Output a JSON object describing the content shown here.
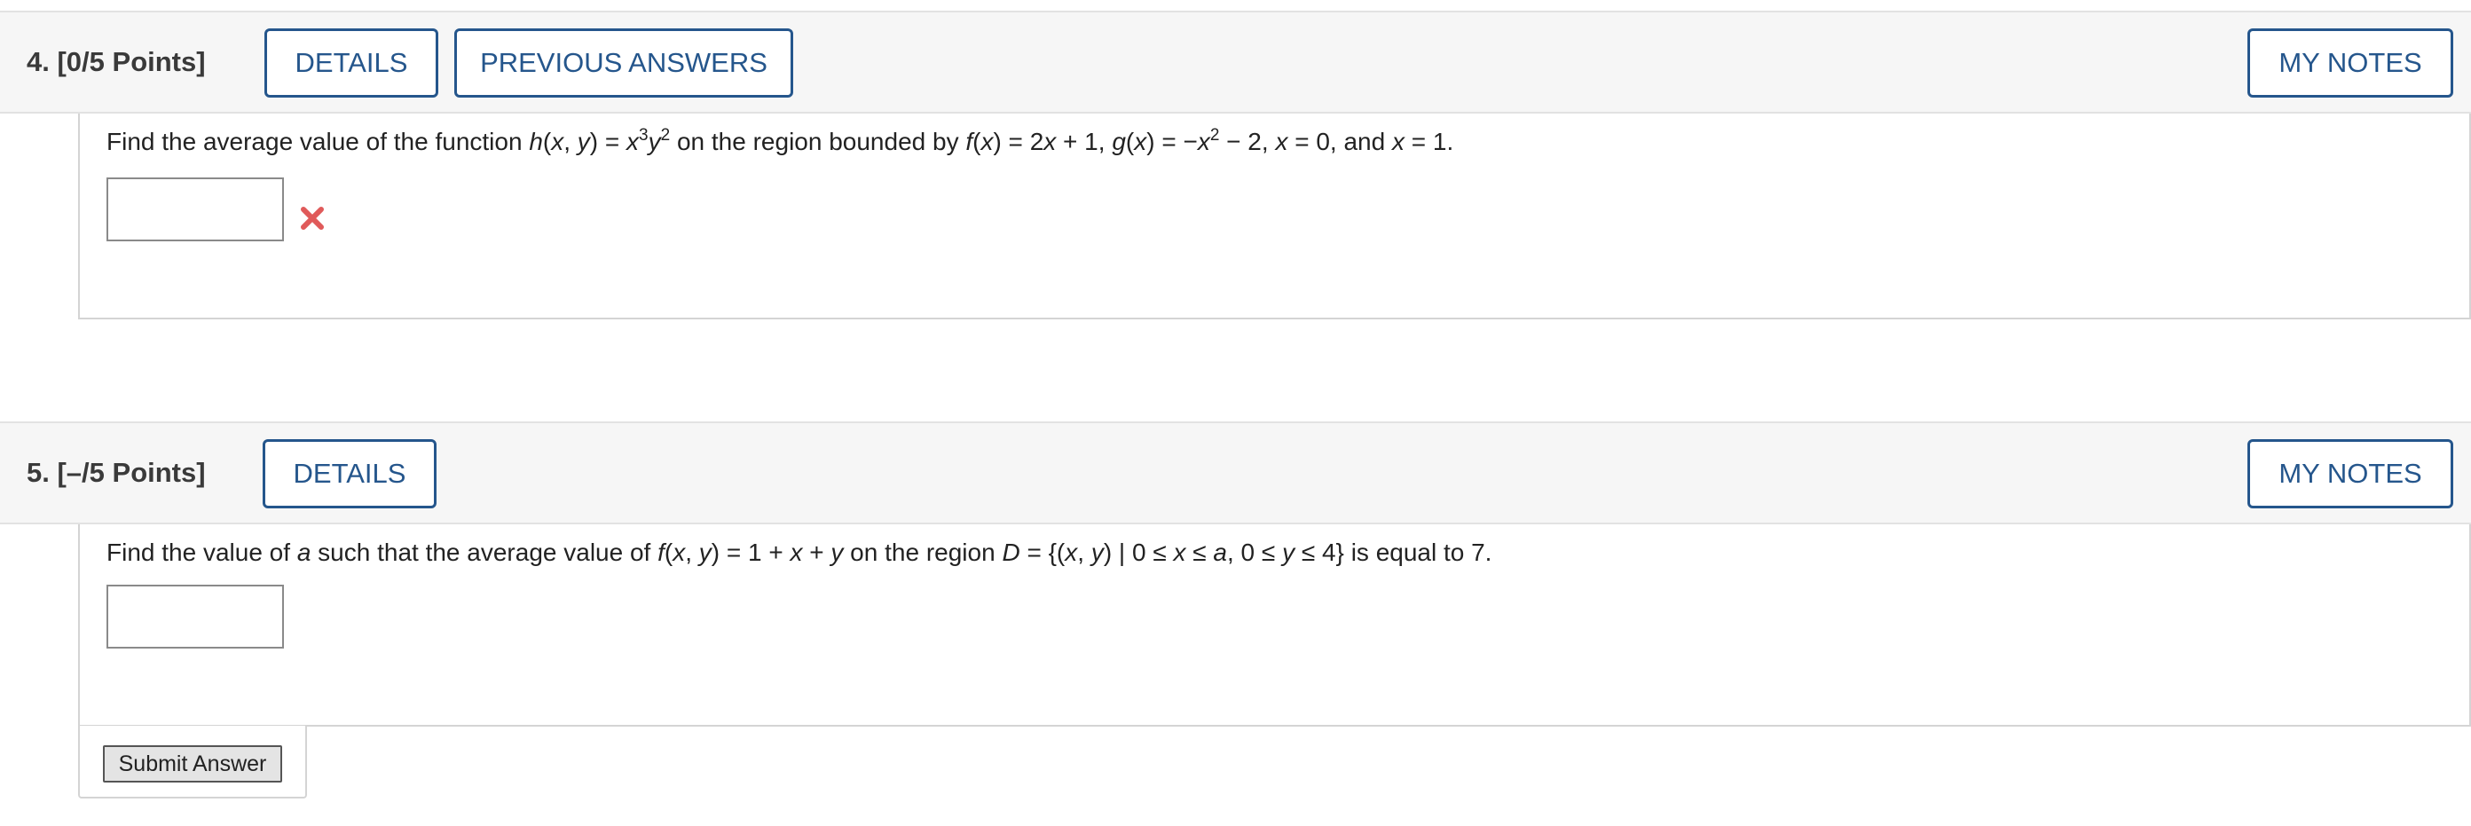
{
  "questions": [
    {
      "number": "4.",
      "points": "[0/5 Points]",
      "details_label": "DETAILS",
      "previous_answers_label": "PREVIOUS ANSWERS",
      "my_notes_label": "MY NOTES",
      "text": {
        "p1": "Find the average value of the function ",
        "h": "h",
        "p2": "(",
        "x1": "x",
        "p3": ", ",
        "y1": "y",
        "p4": ") = ",
        "x2": "x",
        "exp3": "3",
        "y2": "y",
        "exp2a": "2",
        "p5": " on the region bounded by ",
        "f": "f",
        "p6": "(",
        "x3": "x",
        "p7": ") = 2",
        "x4": "x",
        "p8": " + 1, ",
        "g": "g",
        "p9": "(",
        "x5": "x",
        "p10": ") = −",
        "x6": "x",
        "exp2b": "2",
        "p11": " − 2, ",
        "x7": "x",
        "p12": " = 0, and ",
        "x8": "x",
        "p13": " = 1."
      },
      "answer_value": "",
      "status": "incorrect",
      "status_color": "#e05a5a"
    },
    {
      "number": "5.",
      "points": "[–/5 Points]",
      "details_label": "DETAILS",
      "my_notes_label": "MY NOTES",
      "text": {
        "p1": "Find the value of ",
        "a1": "a",
        "p2": " such that the average value of ",
        "f": "f",
        "p3": "(",
        "x1": "x",
        "p4": ", ",
        "y1": "y",
        "p5": ") = 1 + ",
        "x2": "x",
        "p6": " + ",
        "y2": "y",
        "p7": " on the region ",
        "D": "D",
        "p8": " = {(",
        "x3": "x",
        "p9": ", ",
        "y3": "y",
        "p10": ") | 0 ≤ ",
        "x4": "x",
        "p11": " ≤ ",
        "a2": "a",
        "p12": ", 0 ≤ ",
        "y4": "y",
        "p13": " ≤ 4} is equal to 7."
      },
      "answer_value": "",
      "submit_label": "Submit Answer"
    }
  ],
  "colors": {
    "accent": "#25568c",
    "header_bg": "#f6f6f6",
    "border": "#d4d4d4",
    "error": "#e05a5a"
  }
}
